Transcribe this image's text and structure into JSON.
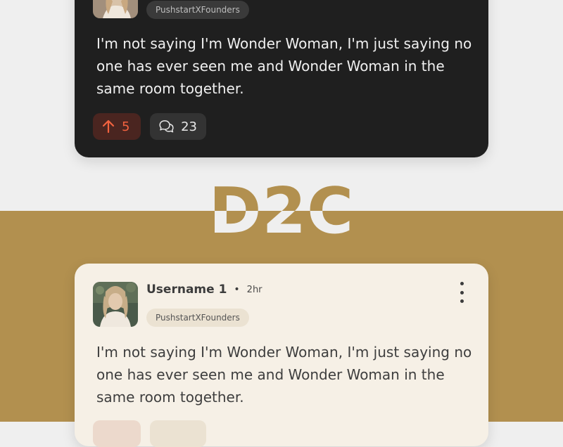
{
  "heading": "D2C",
  "colors": {
    "top_bg": "#efefef",
    "bottom_bg": "#b2904f",
    "dark_card": "#1f1f1f",
    "light_card": "#f6f0e6",
    "upvote_accent": "#f2623f"
  },
  "dark_post": {
    "community": "PushstartXFounders",
    "text": "I'm not saying I'm Wonder Woman, I'm just saying no one has ever seen me and Wonder Woman in the same room together.",
    "upvotes": "5",
    "comments": "23",
    "icons": {
      "upvote": "arrow-up-icon",
      "comment": "speech-bubbles-icon"
    }
  },
  "light_post": {
    "username": "Username 1",
    "separator": "•",
    "time": "2hr",
    "community": "PushstartXFounders",
    "text": "I'm not saying I'm Wonder Woman, I'm just saying no one has ever seen me and Wonder Woman in the same room together.",
    "icons": {
      "more": "kebab-menu-icon"
    }
  }
}
